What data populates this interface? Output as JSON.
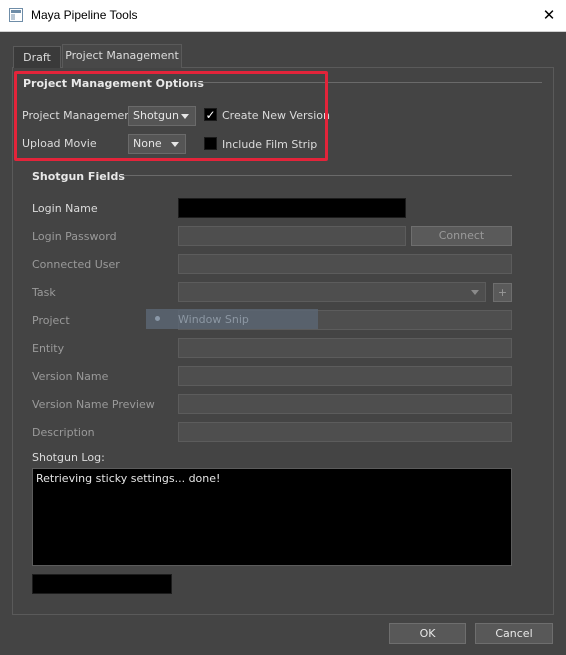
{
  "window": {
    "title": "Maya Pipeline Tools",
    "close_glyph": "✕"
  },
  "tabs": [
    {
      "label": "Draft"
    },
    {
      "label": "Project Management"
    }
  ],
  "pm_options": {
    "title": "Project Management Options",
    "pm_label": "Project Management",
    "pm_value": "Shotgun",
    "create_version_label": "Create New Version",
    "create_version_checked": true,
    "upload_movie_label": "Upload Movie",
    "upload_movie_value": "None",
    "film_strip_label": "Include Film Strip",
    "film_strip_checked": false
  },
  "shotgun_fields": {
    "title": "Shotgun Fields",
    "login_name_label": "Login Name",
    "login_password_label": "Login Password",
    "connect_label": "Connect",
    "connected_user_label": "Connected User",
    "task_label": "Task",
    "add_glyph": "+",
    "project_label": "Project",
    "entity_label": "Entity",
    "version_name_label": "Version Name",
    "version_preview_label": "Version Name Preview",
    "description_label": "Description",
    "log_label": "Shotgun Log:",
    "log_text": "Retrieving sticky settings... done!"
  },
  "overlay": {
    "snip_label": "Window Snip"
  },
  "footer": {
    "ok_label": "OK",
    "cancel_label": "Cancel"
  },
  "colors": {
    "highlight": "#e3243a",
    "background": "#444444"
  }
}
